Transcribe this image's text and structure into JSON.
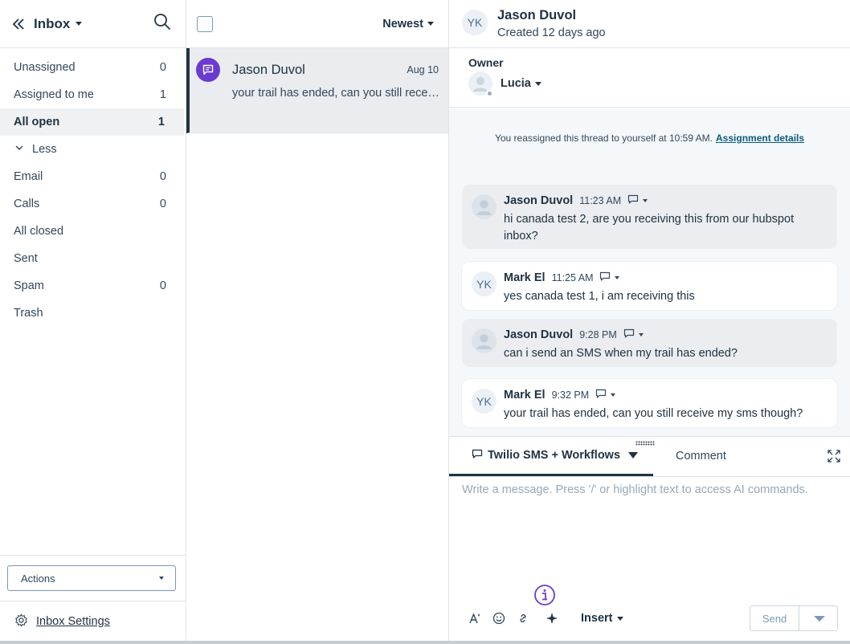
{
  "sidebar": {
    "title": "Inbox",
    "nav": [
      {
        "label": "Unassigned",
        "count": "0"
      },
      {
        "label": "Assigned to me",
        "count": "1"
      },
      {
        "label": "All open",
        "count": "1"
      },
      {
        "label": "Less",
        "count": ""
      },
      {
        "label": "Email",
        "count": "0"
      },
      {
        "label": "Calls",
        "count": "0"
      },
      {
        "label": "All closed",
        "count": ""
      },
      {
        "label": "Sent",
        "count": ""
      },
      {
        "label": "Spam",
        "count": "0"
      },
      {
        "label": "Trash",
        "count": ""
      }
    ],
    "actions_label": "Actions",
    "settings_label": "Inbox Settings"
  },
  "list": {
    "sort_label": "Newest",
    "threads": [
      {
        "name": "Jason Duvol",
        "date": "Aug 10",
        "preview": "your trail has ended, can you still receive my sms though?"
      }
    ]
  },
  "conversation": {
    "initials": "YK",
    "contact_name": "Jason Duvol",
    "created": "Created 12 days ago",
    "owner_label": "Owner",
    "owner_name": "Lucia",
    "system_note": "You reassigned this thread to yourself at 10:59 AM.",
    "system_link": "Assignment details",
    "messages": [
      {
        "author": "Jason Duvol",
        "time": "11:23 AM",
        "direction": "incoming",
        "initials": "",
        "body": "hi canada test 2, are you receiving this from our hubspot inbox?"
      },
      {
        "author": "Mark El",
        "time": "11:25 AM",
        "direction": "outgoing",
        "initials": "YK",
        "body": "yes canada test 1, i am receiving this"
      },
      {
        "author": "Jason Duvol",
        "time": "9:28 PM",
        "direction": "incoming",
        "initials": "",
        "body": "can i send an SMS when my trail has ended?"
      },
      {
        "author": "Mark El",
        "time": "9:32 PM",
        "direction": "outgoing",
        "initials": "YK",
        "body": "your trail has ended, can you still receive my sms though?"
      }
    ]
  },
  "composer": {
    "channel_tab": "Twilio SMS + Workflows",
    "comment_tab": "Comment",
    "placeholder": "Write a message. Press '/' or highlight text to access AI commands.",
    "insert_label": "Insert",
    "send_label": "Send"
  },
  "colors": {
    "accent_purple": "#6a3bd1",
    "text_dark": "#213343",
    "link": "#0b5c7d"
  }
}
